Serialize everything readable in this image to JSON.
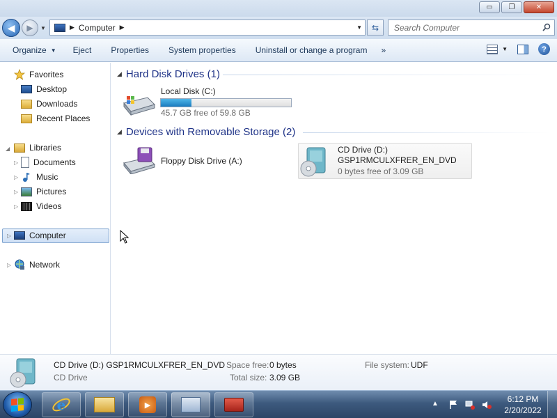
{
  "window": {
    "caption_buttons": {
      "minimize": "▭",
      "maximize": "❐",
      "close": "✕"
    }
  },
  "address": {
    "path": "Computer",
    "search_placeholder": "Search Computer"
  },
  "toolbar": {
    "organize": "Organize",
    "eject": "Eject",
    "properties": "Properties",
    "system_properties": "System properties",
    "uninstall": "Uninstall or change a program",
    "more": "»"
  },
  "nav": {
    "favorites": "Favorites",
    "desktop": "Desktop",
    "downloads": "Downloads",
    "recent_places": "Recent Places",
    "libraries": "Libraries",
    "documents": "Documents",
    "music": "Music",
    "pictures": "Pictures",
    "videos": "Videos",
    "computer": "Computer",
    "network": "Network"
  },
  "groups": {
    "hdd": {
      "header": "Hard Disk Drives (1)",
      "drives": [
        {
          "name": "Local Disk (C:)",
          "free": "45.7 GB free of 59.8 GB",
          "used_fraction": 0.236
        }
      ]
    },
    "removable": {
      "header": "Devices with Removable Storage (2)",
      "drives": [
        {
          "name": "Floppy Disk Drive (A:)"
        },
        {
          "name": "CD Drive (D:)",
          "label": "GSP1RMCULXFRER_EN_DVD",
          "free": "0 bytes free of 3.09 GB"
        }
      ]
    }
  },
  "details": {
    "title": "CD Drive (D:) GSP1RMCULXFRER_EN_DVD",
    "type": "CD Drive",
    "space_free_label": "Space free:",
    "space_free": "0 bytes",
    "total_size_label": "Total size:",
    "total_size": "3.09 GB",
    "fs_label": "File system:",
    "fs": "UDF"
  },
  "taskbar": {
    "time": "6:12 PM",
    "date": "2/20/2022"
  },
  "colors": {
    "group_header": "#1e3287",
    "selection": "#cfe0f5",
    "taskbar": "#3d5a7e",
    "usage_fill": "#1a7cbf"
  }
}
